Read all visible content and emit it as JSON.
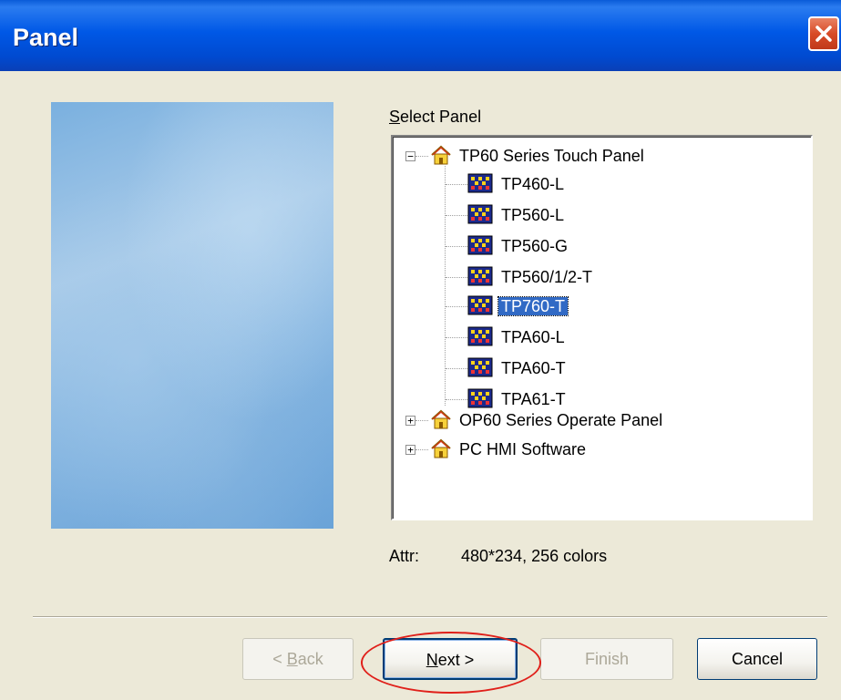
{
  "window": {
    "title": "Panel"
  },
  "select_panel_label": {
    "prefix": "S",
    "rest": "elect Panel"
  },
  "tree": {
    "groups": [
      {
        "label": "TP60 Series Touch Panel",
        "expander": "−"
      },
      {
        "label": "OP60 Series Operate Panel",
        "expander": "+"
      },
      {
        "label": "PC HMI Software",
        "expander": "+"
      }
    ],
    "items": [
      "TP460-L",
      "TP560-L",
      "TP560-G",
      "TP560/1/2-T",
      "TP760-T",
      "TPA60-L",
      "TPA60-T",
      "TPA61-T"
    ],
    "selected": "TP760-T"
  },
  "attr": {
    "label": "Attr:",
    "value": "480*234, 256 colors"
  },
  "buttons": {
    "back": {
      "prefix": "< ",
      "key": "B",
      "rest": "ack"
    },
    "next": {
      "key": "N",
      "rest": "ext >"
    },
    "finish": "Finish",
    "cancel": "Cancel"
  },
  "colors": {
    "titlebar": "#0058e6",
    "selection": "#316ac5",
    "highlight_circle": "#e0201a"
  }
}
